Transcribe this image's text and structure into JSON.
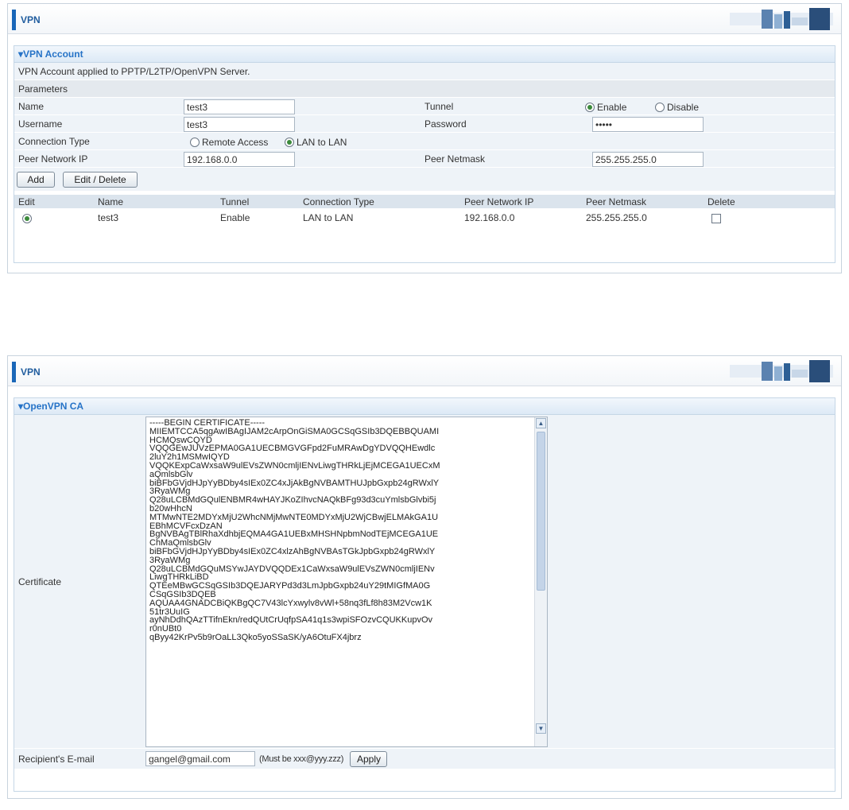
{
  "top": {
    "header_title": "VPN",
    "section_title": "▾VPN Account",
    "info_text": "VPN Account applied to PPTP/L2TP/OpenVPN Server.",
    "parameters_label": "Parameters",
    "name_label": "Name",
    "name_value": "test3",
    "tunnel_label": "Tunnel",
    "tunnel_enable": "Enable",
    "tunnel_disable": "Disable",
    "username_label": "Username",
    "username_value": "test3",
    "password_label": "Password",
    "password_value": "•••••",
    "connection_type_label": "Connection Type",
    "remote_access": "Remote Access",
    "lan_to_lan": "LAN to LAN",
    "peer_network_ip_label": "Peer Network IP",
    "peer_network_ip_value": "192.168.0.0",
    "peer_netmask_label": "Peer Netmask",
    "peer_netmask_value": "255.255.255.0",
    "add_button": "Add",
    "edit_delete_button": "Edit / Delete",
    "table_headers": [
      "Edit",
      "Name",
      "Tunnel",
      "Connection Type",
      "Peer Network IP",
      "Peer Netmask",
      "Delete"
    ],
    "table_rows": [
      {
        "name": "test3",
        "tunnel": "Enable",
        "connection_type": "LAN to LAN",
        "peer_network_ip": "192.168.0.0",
        "peer_netmask": "255.255.255.0"
      }
    ]
  },
  "bottom": {
    "header_title": "VPN",
    "section_title": "▾OpenVPN CA",
    "certificate_label": "Certificate",
    "certificate_text": "-----BEGIN CERTIFICATE-----\nMIIEMTCCA5qgAwIBAgIJAM2cArpOnGiSMA0GCSqGSIb3DQEBBQUAMI\nHCMQswCQYD\nVQQGEwJUVzEPMA0GA1UECBMGVGFpd2FuMRAwDgYDVQQHEwdlc\n2luY2h1MSMwIQYD\nVQQKExpCaWxsaW9ulEVsZWN0cmljIENvLiwgTHRkLjEjMCEGA1UECxM\naQmlsbGlv\nbiBFbGVjdHJpYyBDby4sIEx0ZC4xJjAkBgNVBAMTHUJpbGxpb24gRWxlY\n3RyaWMg\nQ28uLCBMdGQulENBMR4wHAYJKoZIhvcNAQkBFg93d3cuYmlsbGlvbi5j\nb20wHhcN\nMTMwNTE2MDYxMjU2WhcNMjMwNTE0MDYxMjU2WjCBwjELMAkGA1U\nEBhMCVFcxDzAN\nBgNVBAgTBlRhaXdhbjEQMA4GA1UEBxMHSHNpbmNodTEjMCEGA1UE\nChMaQmlsbGlv\nbiBFbGVjdHJpYyBDby4sIEx0ZC4xlzAhBgNVBAsTGkJpbGxpb24gRWxlY\n3RyaWMg\nQ28uLCBMdGQuMSYwJAYDVQQDEx1CaWxsaW9ulEVsZWN0cmljIENv\nLiwgTHRkLiBD\nQTEeMBwGCSqGSIb3DQEJARYPd3d3LmJpbGxpb24uY29tMIGfMA0G\nCSqGSIb3DQEB\nAQUAA4GNADCBiQKBgQC7V43lcYxwylv8vWl+58nq3fLf8h83M2Vcw1K\n51tr3UuIG\nayNhDdhQAzTTifnEkn/redQUtCrUqfpSA41q1s3wpiSFOzvCQUKKupvOv\nr0nUBt0\nqByy42KrPv5b9rOaLL3Qko5yoSSaSK/yA6OtuFX4jbrz",
    "email_label": "Recipient's E-mail",
    "email_value": "gangel@gmail.com",
    "email_hint": "(Must be xxx@yyy.zzz)",
    "apply_button": "Apply"
  },
  "colors": {
    "accent": "#1a67b8",
    "section_title": "#2673c7",
    "row_light": "#eef3f8",
    "row_gray": "#e4e9ee"
  }
}
